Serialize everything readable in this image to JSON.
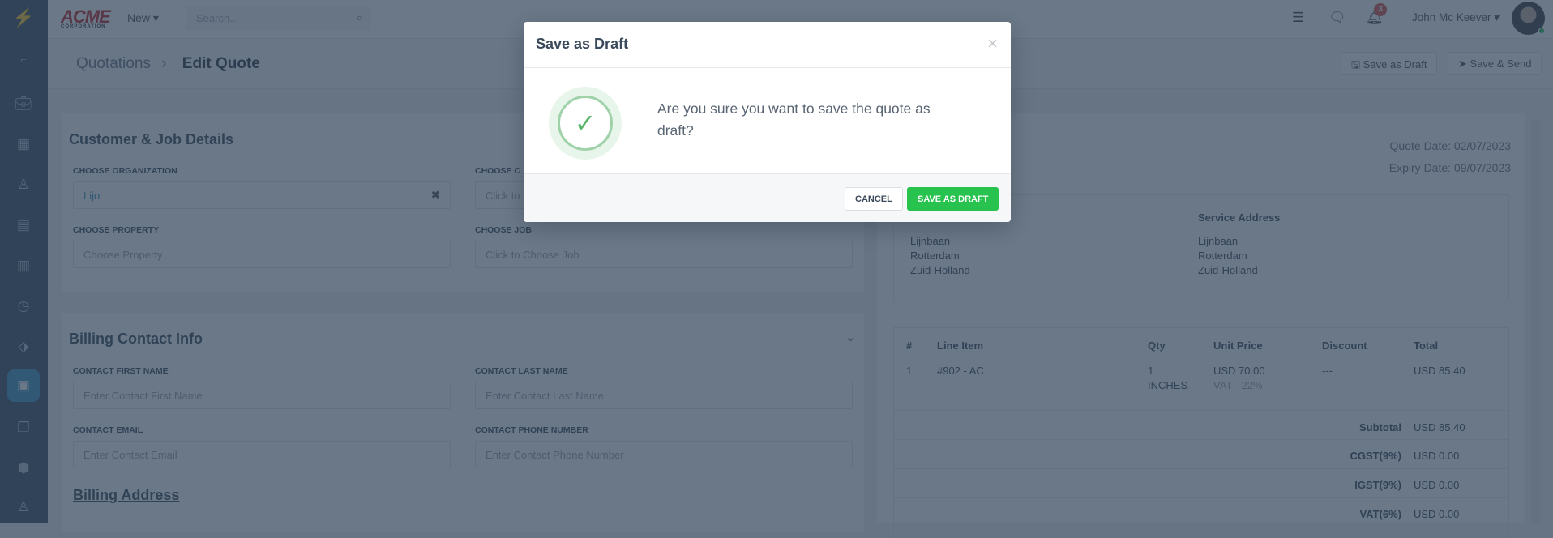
{
  "topbar": {
    "logo_text": "ACME",
    "logo_sub": "CORPORATION",
    "new_label": "New",
    "search_placeholder": "Search..",
    "notification_count": "3",
    "user_name": "John Mc Keever"
  },
  "breadcrumb": {
    "parent": "Quotations",
    "separator": "›",
    "current": "Edit Quote"
  },
  "header_buttons": {
    "save_draft": "Save as Draft",
    "save_send": "Save & Send"
  },
  "customer_job": {
    "title": "Customer & Job Details",
    "org_label": "CHOOSE ORGANIZATION",
    "org_value": "Lijo",
    "contact_label": "CHOOSE C",
    "contact_placeholder": "Click to",
    "property_label": "CHOOSE PROPERTY",
    "property_placeholder": "Choose Property",
    "job_label": "CHOOSE JOB",
    "job_placeholder": "Click to Choose Job"
  },
  "billing_contact": {
    "title": "Billing Contact Info",
    "first_label": "CONTACT FIRST NAME",
    "first_placeholder": "Enter Contact First Name",
    "last_label": "CONTACT LAST NAME",
    "last_placeholder": "Enter Contact Last Name",
    "email_label": "CONTACT EMAIL",
    "email_placeholder": "Enter Contact Email",
    "phone_label": "CONTACT PHONE NUMBER",
    "phone_placeholder": "Enter Contact Phone Number",
    "billing_address_heading": "Billing Address"
  },
  "quote": {
    "quote_date": "Quote Date: 02/07/2023",
    "expiry_date": "Expiry Date: 09/07/2023",
    "billing_address": [
      "Lijnbaan",
      "Rotterdam",
      "Zuid-Holland"
    ],
    "service_address_title": "Service Address",
    "service_address": [
      "Lijnbaan",
      "Rotterdam",
      "Zuid-Holland"
    ],
    "columns": [
      "#",
      "Line Item",
      "Qty",
      "Unit Price",
      "Discount",
      "Total"
    ],
    "items": [
      {
        "num": "1",
        "name": "#902 - AC",
        "qty": "1",
        "unit": "INCHES",
        "price": "USD 70.00",
        "tax": "VAT - 22%",
        "discount": "---",
        "total": "USD 85.40"
      }
    ],
    "totals": [
      {
        "label": "Subtotal",
        "value": "USD 85.40"
      },
      {
        "label": "CGST(9%)",
        "value": "USD 0.00"
      },
      {
        "label": "IGST(9%)",
        "value": "USD 0.00"
      },
      {
        "label": "VAT(6%)",
        "value": "USD 0.00"
      }
    ]
  },
  "modal": {
    "title": "Save as Draft",
    "close": "×",
    "message": "Are you sure you want to save the quote as draft?",
    "cancel": "CANCEL",
    "confirm": "SAVE AS DRAFT"
  },
  "colors": {
    "accent": "#3f93c2",
    "confirm": "#28c24e",
    "sidebar": "#3c4d61"
  }
}
